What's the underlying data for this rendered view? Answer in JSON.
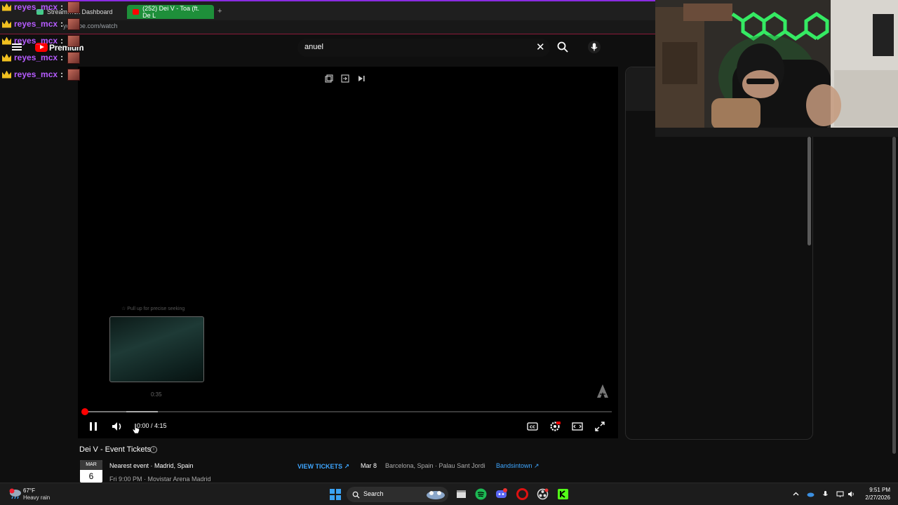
{
  "browser": {
    "tabs": [
      {
        "label": "Stream…ck Dashboard",
        "active": false
      },
      {
        "label": "(252) Dei V - Toa (ft. De L",
        "active": true
      }
    ],
    "new_tab_symbol": "+",
    "url": "youtube.com/watch"
  },
  "header": {
    "logo_text": "Premium",
    "search_value": "anuel",
    "clear_symbol": "✕"
  },
  "chat_overlay": {
    "user": "reyes_mcx",
    "separator": ":",
    "lines": 5
  },
  "player": {
    "seek_hint": "☆ Pull up for precise seeking",
    "preview_time": "0:35",
    "time_display": "0:00 / 4:15",
    "progress_fraction": 0.0,
    "buffered_fraction": 0.08,
    "hover_fraction": 0.14
  },
  "events": {
    "title": "Dei V - Event Tickets",
    "info_symbol": "i",
    "nearest": {
      "month": "MAR",
      "day": "6",
      "label": "Nearest event · Madrid, Spain",
      "time": "Fri 9:00 PM · Movistar Arena Madrid",
      "cta": "VIEW TICKETS ↗"
    },
    "next": {
      "date": "Mar 8",
      "place": "Barcelona, Spain · Palau Sant Jordi",
      "source": "Bandsintown ↗"
    }
  },
  "taskbar": {
    "weather_temp": "67°F",
    "weather_desc": "Heavy rain",
    "search_label": "Search",
    "time": "9:51 PM",
    "date": "2/27/2026"
  },
  "colors": {
    "accent_red": "#ff0000",
    "link_blue": "#3ea6ff",
    "chat_purple": "#b65cff",
    "tab_green": "#1e8f3a"
  }
}
